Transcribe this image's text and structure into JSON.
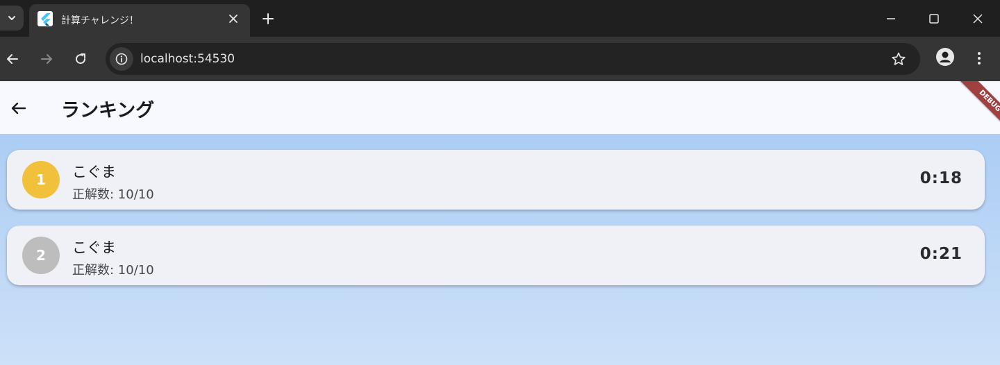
{
  "browser": {
    "tab": {
      "title": "計算チャレンジ！",
      "favicon": "flutter-logo-icon"
    },
    "address_bar": {
      "url": "localhost:54530"
    },
    "icons": {
      "tab_list": "chevron-down-icon",
      "tab_close": "close-icon",
      "new_tab": "plus-icon",
      "minimize": "minimize-icon",
      "maximize": "maximize-icon",
      "close_window": "close-icon",
      "back": "arrow-left-icon",
      "forward": "arrow-right-icon",
      "reload": "reload-icon",
      "site_info": "info-icon",
      "bookmark": "star-icon",
      "profile": "person-icon",
      "menu": "kebab-menu-icon"
    }
  },
  "app": {
    "appbar": {
      "title": "ランキング",
      "back_icon": "arrow-left-icon"
    },
    "debug_banner": "DEBUG",
    "colors": {
      "gold": "#f2c13b",
      "silver": "#bdbdbd",
      "debug_banner": "#a04040"
    },
    "ranking": [
      {
        "rank": "1",
        "name": "こぐま",
        "score": "正解数: 10/10",
        "time": "0:18",
        "badge_color": "#f2c13b"
      },
      {
        "rank": "2",
        "name": "こぐま",
        "score": "正解数: 10/10",
        "time": "0:21",
        "badge_color": "#bdbdbd"
      }
    ]
  }
}
